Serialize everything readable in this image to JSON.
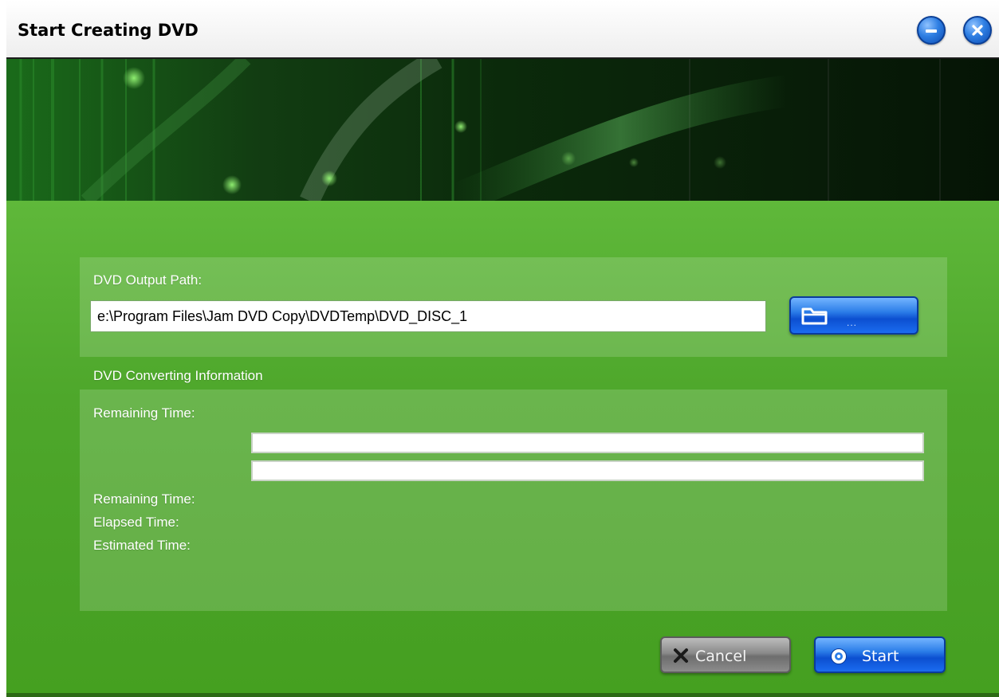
{
  "window": {
    "title": "Start Creating DVD",
    "minimize_icon": "minimize-icon",
    "close_icon": "close-icon"
  },
  "output": {
    "label": "DVD Output Path:",
    "path_value": "e:\\Program Files\\Jam DVD Copy\\DVDTemp\\DVD_DISC_1",
    "browse_icon": "folder-icon",
    "browse_label": "..."
  },
  "info": {
    "section_title": "DVD Converting Information",
    "remaining_time_label_top": "Remaining Time:",
    "progress_bars": [
      {
        "value": 0
      },
      {
        "value": 0
      }
    ],
    "remaining_time_label": "Remaining Time:",
    "elapsed_time_label": "Elapsed Time:",
    "estimated_time_label": "Estimated Time:"
  },
  "buttons": {
    "cancel_label": "Cancel",
    "cancel_icon": "x-icon",
    "start_label": "Start",
    "start_icon": "disc-icon"
  },
  "colors": {
    "background_green": "#4ea72b",
    "button_blue": "#2b7de8",
    "button_gray": "#8a8a8a"
  }
}
